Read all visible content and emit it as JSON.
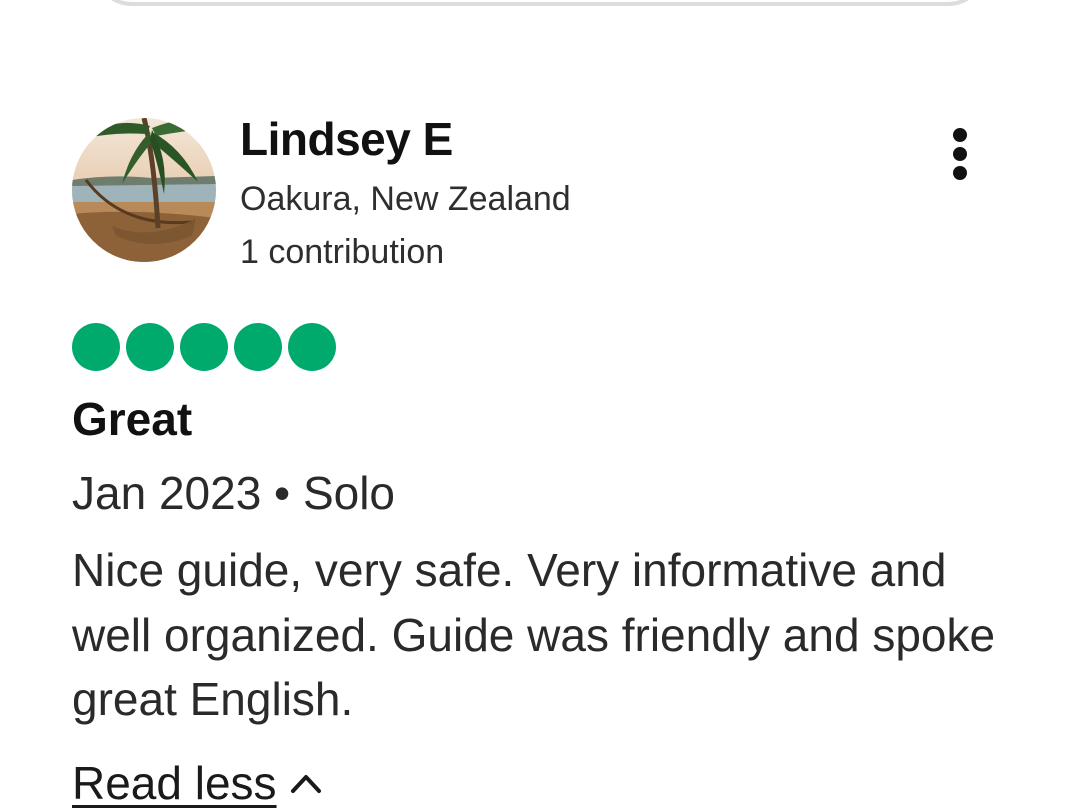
{
  "review": {
    "reviewer": {
      "name": "Lindsey E",
      "location": "Oakura, New Zealand",
      "contributions": "1 contribution",
      "avatar_icon": "beach-hammock-photo"
    },
    "more_options_icon": "more-vertical-icon",
    "rating": {
      "value": 5,
      "max": 5,
      "color": "#00aa6c"
    },
    "title": "Great",
    "meta": "Jan 2023 • Solo",
    "body": "Nice guide, very safe. Very informative and well organized. Guide was friendly and spoke great English.",
    "read_less_label": "Read less",
    "read_less_icon": "chevron-up-icon"
  }
}
